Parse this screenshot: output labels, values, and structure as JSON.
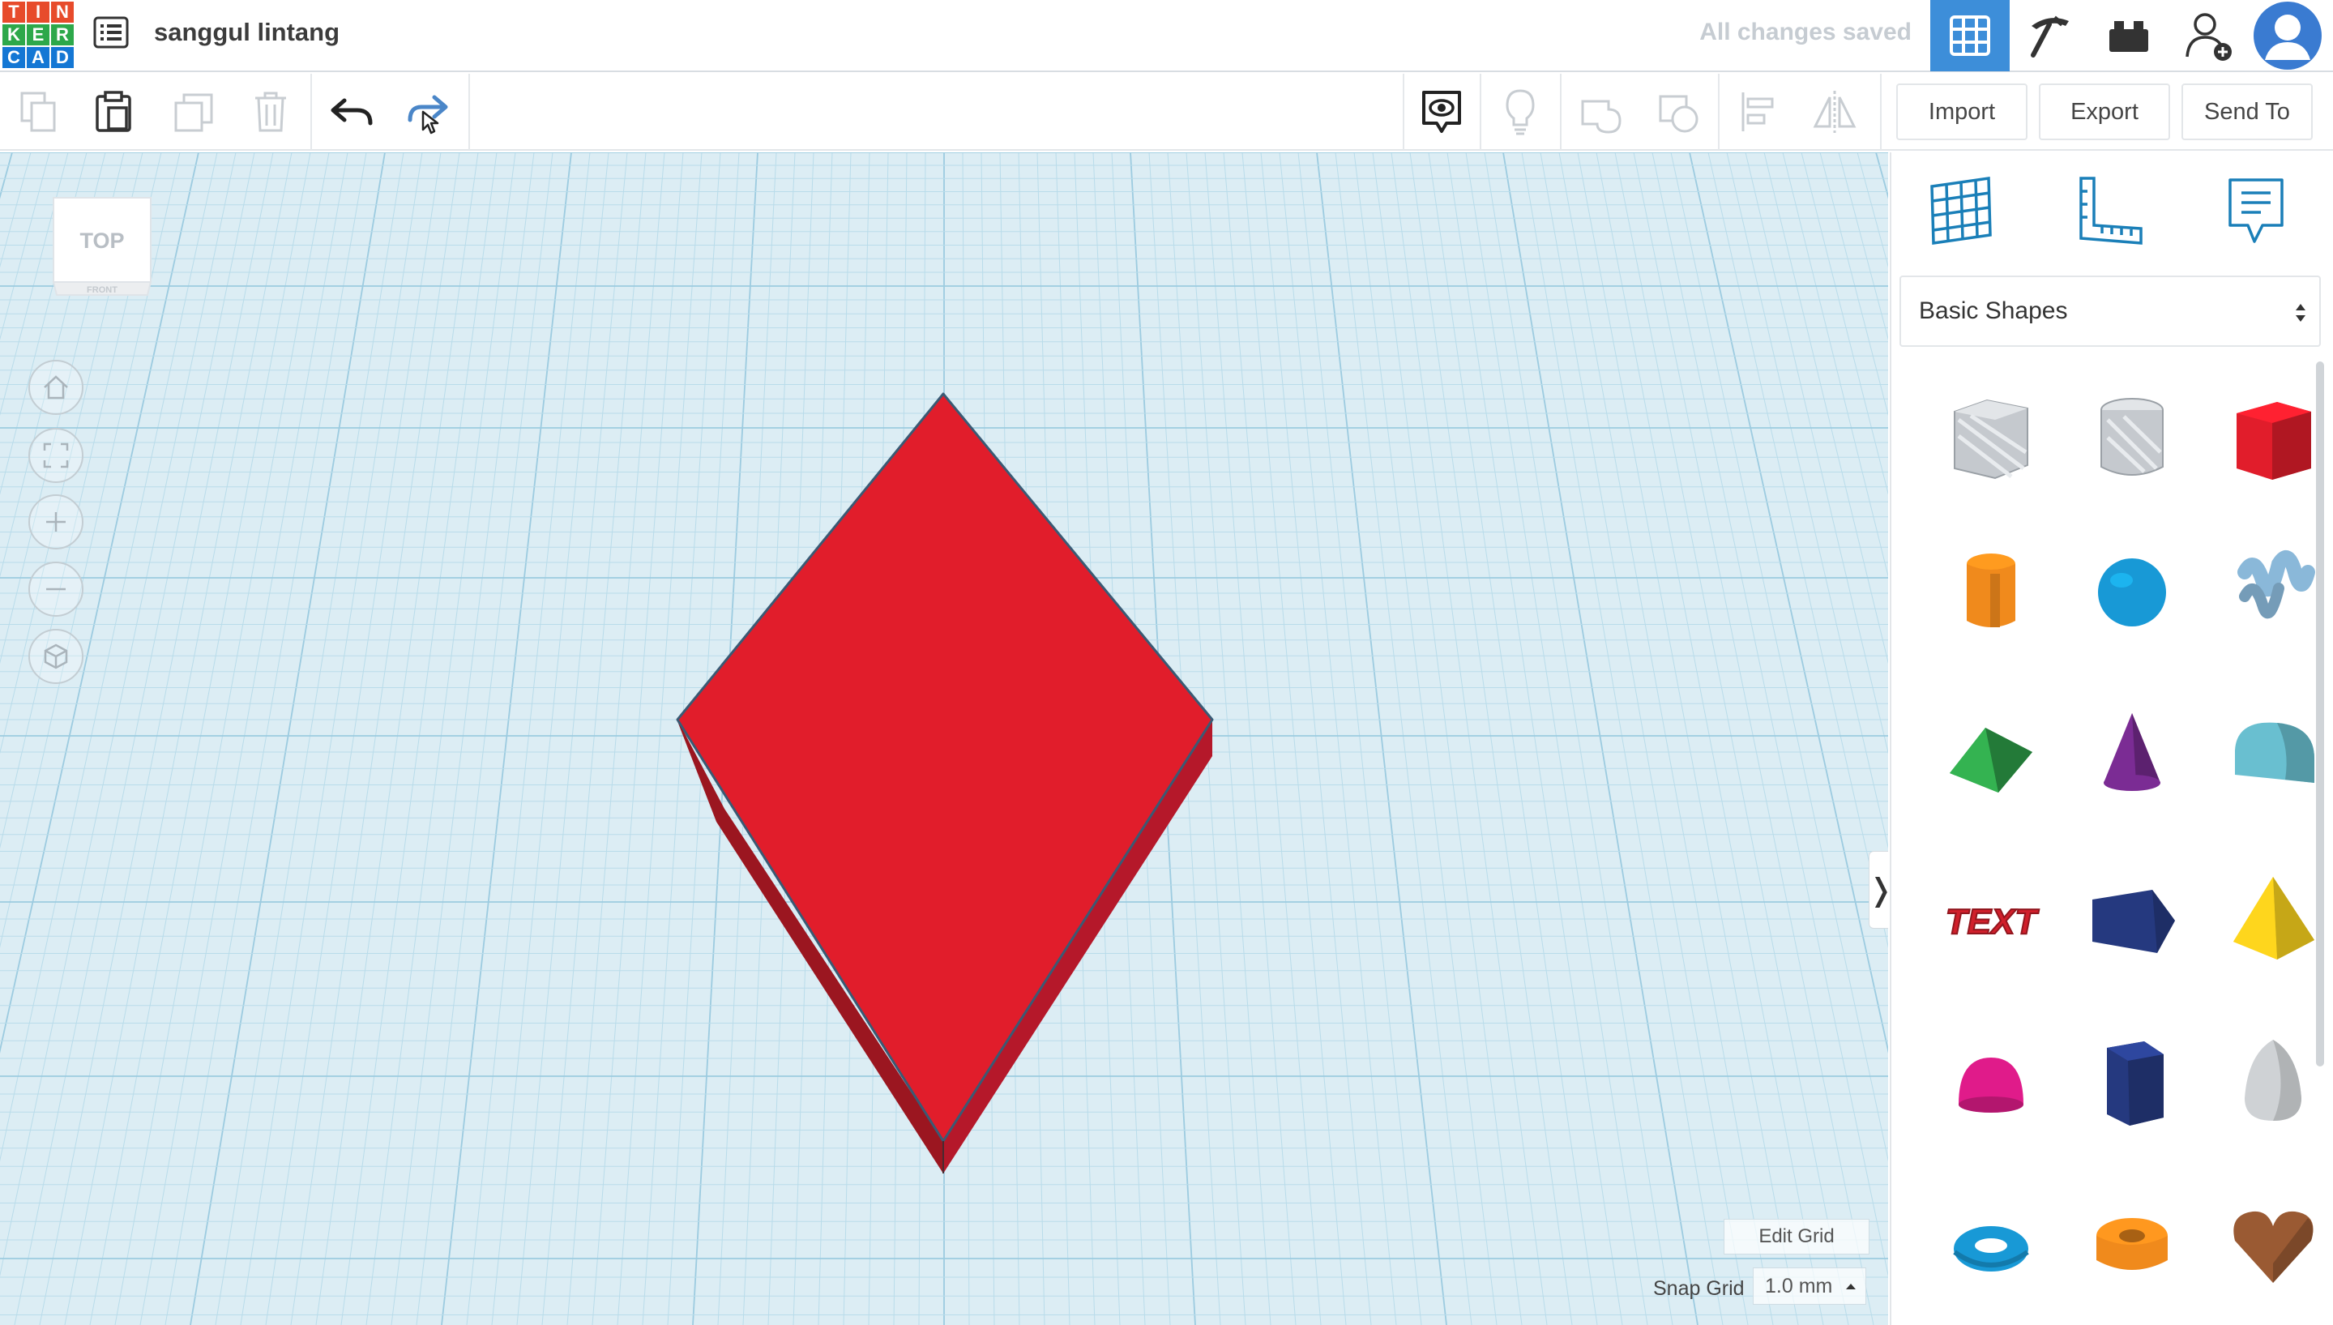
{
  "app": {
    "logo_letters": [
      "T",
      "I",
      "N",
      "K",
      "E",
      "R",
      "C",
      "A",
      "D"
    ],
    "logo_colors": [
      "#e74b2b",
      "#e74b2b",
      "#e74b2b",
      "#2da84a",
      "#2da84a",
      "#2da84a",
      "#1477d4",
      "#1477d4",
      "#1477d4"
    ],
    "design_name": "sanggul lintang",
    "save_status": "All changes saved"
  },
  "topbar": {
    "icons": [
      "3d-design-grid-icon",
      "build-pickaxe-icon",
      "bricks-icon",
      "invite-user-icon",
      "user-avatar-icon"
    ]
  },
  "toolbar": {
    "edit_tools": [
      "copy-icon",
      "paste-icon",
      "duplicate-icon",
      "delete-icon",
      "undo-icon",
      "redo-icon"
    ],
    "view_tools": [
      "show-notes-icon",
      "light-bulb-icon",
      "group-icon",
      "ungroup-icon",
      "align-icon",
      "mirror-icon"
    ],
    "import_label": "Import",
    "export_label": "Export",
    "send_to_label": "Send To"
  },
  "workplane": {
    "viewcube_top": "TOP",
    "viewcube_front": "FRONT",
    "nav_icons": [
      "home-view-icon",
      "fit-view-icon",
      "zoom-in-icon",
      "zoom-out-icon",
      "ortho-view-icon"
    ],
    "edit_grid_label": "Edit Grid",
    "snap_grid_label": "Snap Grid",
    "snap_grid_value": "1.0 mm",
    "object": {
      "shape": "diamond box",
      "color": "#e11d2b"
    }
  },
  "panel": {
    "tools": [
      "workplane-icon",
      "ruler-icon",
      "notes-icon"
    ],
    "category": "Basic Shapes",
    "shapes": [
      {
        "name": "Box Hole",
        "color": "#c5c9ce"
      },
      {
        "name": "Cylinder Hole",
        "color": "#c5c9ce"
      },
      {
        "name": "Box",
        "color": "#e11d2b"
      },
      {
        "name": "Cylinder",
        "color": "#f08a1c"
      },
      {
        "name": "Sphere",
        "color": "#1899d6"
      },
      {
        "name": "Scribble",
        "color": "#8ab8d9"
      },
      {
        "name": "Roof",
        "color": "#2fa34a"
      },
      {
        "name": "Cone",
        "color": "#7b2c94"
      },
      {
        "name": "Round Roof",
        "color": "#69bfd0"
      },
      {
        "name": "Text",
        "color": "#d11f2b"
      },
      {
        "name": "Box (Wedge)",
        "color": "#25397f"
      },
      {
        "name": "Pyramid",
        "color": "#f2cc1c"
      },
      {
        "name": "Half Sphere",
        "color": "#e01b8a"
      },
      {
        "name": "Polygon",
        "color": "#25397f"
      },
      {
        "name": "Paraboloid",
        "color": "#cfd2d5"
      },
      {
        "name": "Torus",
        "color": "#1899d6"
      },
      {
        "name": "Tube",
        "color": "#f08a1c"
      },
      {
        "name": "Heart",
        "color": "#9a5a33"
      }
    ]
  }
}
